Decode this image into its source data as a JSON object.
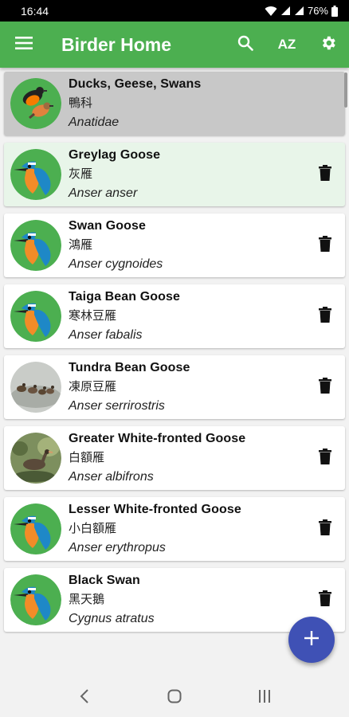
{
  "status_bar": {
    "time": "16:44",
    "battery": "76%"
  },
  "app_bar": {
    "title": "Birder Home",
    "sort_label": "AZ"
  },
  "family": {
    "common_name": "Ducks, Geese, Swans",
    "chinese_name": "鴨科",
    "scientific_name": "Anatidae",
    "icon": "robin-pair-avatar"
  },
  "birds": [
    {
      "common_name": "Greylag Goose",
      "chinese_name": "灰雁",
      "scientific_name": "Anser anser",
      "avatar": "kingfisher-placeholder"
    },
    {
      "common_name": "Swan Goose",
      "chinese_name": "鴻雁",
      "scientific_name": "Anser cygnoides",
      "avatar": "kingfisher-placeholder"
    },
    {
      "common_name": "Taiga Bean Goose",
      "chinese_name": "寒林豆雁",
      "scientific_name": "Anser fabalis",
      "avatar": "kingfisher-placeholder"
    },
    {
      "common_name": "Tundra Bean Goose",
      "chinese_name": "凍原豆雁",
      "scientific_name": "Anser serrirostris",
      "avatar": "geese-photo"
    },
    {
      "common_name": "Greater White-fronted Goose",
      "chinese_name": "白額雁",
      "scientific_name": "Anser albifrons",
      "avatar": "goose-photo"
    },
    {
      "common_name": "Lesser White-fronted Goose",
      "chinese_name": "小白額雁",
      "scientific_name": "Anser erythropus",
      "avatar": "kingfisher-placeholder"
    },
    {
      "common_name": "Black Swan",
      "chinese_name": "黑天鵝",
      "scientific_name": "Cygnus atratus",
      "avatar": "kingfisher-placeholder"
    }
  ],
  "colors": {
    "app_bar": "#4caf50",
    "fab": "#3f51b5",
    "selected_row": "#e8f5e9",
    "family_row": "#c8c8c8"
  }
}
